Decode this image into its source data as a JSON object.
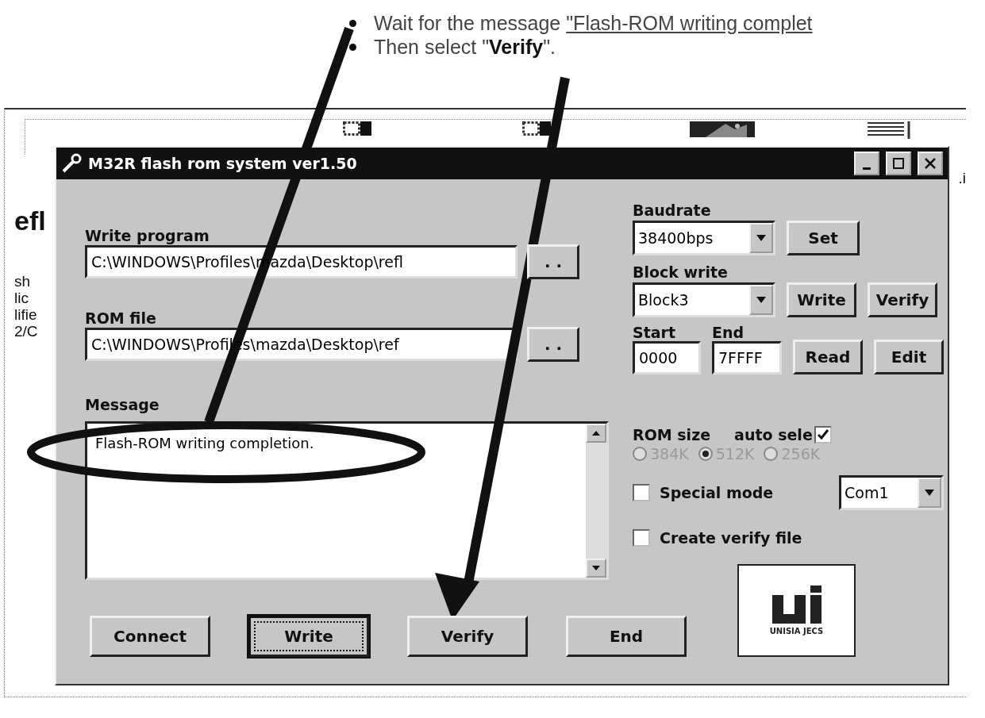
{
  "instructions": [
    {
      "text": "Wait for the message ",
      "link": "\"Flash-ROM writing complet"
    },
    {
      "text": "Then select \"**Verify**\"."
    }
  ],
  "background_page": {
    "left_fragments": [
      "efl",
      "sh",
      "lic",
      "lifie",
      "2/C"
    ],
    "right_fragment": ".i"
  },
  "window": {
    "title": "M32R flash rom system ver1.50"
  },
  "write_program": {
    "label": "Write program",
    "value": "C:\\WINDOWS\\Profiles\\mazda\\Desktop\\refl",
    "browse": ". ."
  },
  "rom_file": {
    "label": "ROM file",
    "value": "C:\\WINDOWS\\Profiles\\mazda\\Desktop\\ref",
    "browse": ". ."
  },
  "message": {
    "label": "Message",
    "text": "Flash-ROM writing completion."
  },
  "baudrate": {
    "label": "Baudrate",
    "value": "38400bps",
    "button": "Set"
  },
  "block_write": {
    "label": "Block write",
    "value": "Block3",
    "buttons": [
      "Write",
      "Verify"
    ]
  },
  "range": {
    "start_label": "Start",
    "start": "0000",
    "end_label": "End",
    "end": "7FFFF",
    "buttons": [
      "Read",
      "Edit"
    ]
  },
  "rom_size": {
    "label": "ROM size",
    "auto_label": "auto sele",
    "auto_checked": true,
    "options": [
      {
        "label": "384K",
        "selected": false
      },
      {
        "label": "512K",
        "selected": true
      },
      {
        "label": "256K",
        "selected": false
      }
    ]
  },
  "options": [
    {
      "label": "Special mode",
      "checked": false
    },
    {
      "label": "Create verify file",
      "checked": false
    }
  ],
  "port": {
    "value": "Com1"
  },
  "buttons": [
    {
      "label": "Connect",
      "focused": false
    },
    {
      "label": "Write",
      "focused": true
    },
    {
      "label": "Verify",
      "focused": false
    },
    {
      "label": "End",
      "focused": false
    }
  ],
  "logo": {
    "caption": "UNISIA JECS"
  }
}
